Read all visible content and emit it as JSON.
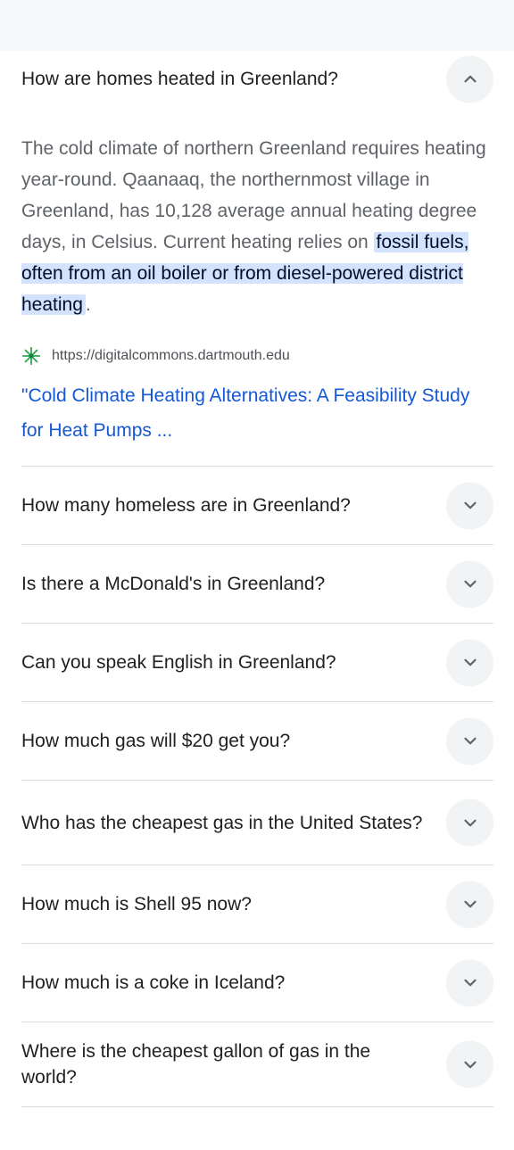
{
  "expanded": {
    "question": "How are homes heated in Greenland?",
    "answer_prefix": "The cold climate of northern Greenland requires heating year-round. Qaanaaq, the northernmost village in Greenland, has 10,128 average annual heating degree days, in Celsius. Current heating relies on ",
    "answer_highlight": "fossil fuels, often from an oil boiler or from diesel-powered district heating",
    "answer_suffix": ".",
    "source_url": "https://digitalcommons.dartmouth.edu",
    "source_title": "\"Cold Climate Heating Alternatives: A Feasibility Study for Heat Pumps ..."
  },
  "questions": [
    {
      "text": "How many homeless are in Greenland?"
    },
    {
      "text": "Is there a McDonald's in Greenland?"
    },
    {
      "text": "Can you speak English in Greenland?"
    },
    {
      "text": "How much gas will $20 get you?"
    },
    {
      "text": "Who has the cheapest gas in the United States?"
    },
    {
      "text": "How much is Shell 95 now?"
    },
    {
      "text": "How much is a coke in Iceland?"
    },
    {
      "text": "Where is the cheapest gallon of gas in the world?"
    }
  ],
  "colors": {
    "highlight": "#d3e3fd",
    "link": "#1558d6",
    "favicon": "#34a853"
  },
  "icons": {
    "collapse": "chevron-up-icon",
    "expand": "chevron-down-icon",
    "favicon": "site-favicon-icon"
  }
}
